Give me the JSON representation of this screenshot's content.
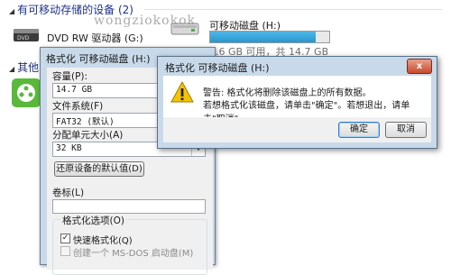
{
  "explorer": {
    "removable_header": "有可移动存储的设备 (2)",
    "other_header": "其他",
    "dvd_label": "DVD RW 驱动器 (G:)",
    "usb_title": "可移动磁盘 (H:)",
    "usb_free": "1.6 GB 可用，共 14.7 GB",
    "usb_used_fraction": 0.89
  },
  "watermark": "wongziokokok",
  "format_dialog": {
    "title": "格式化 可移动磁盘 (H:)",
    "capacity_label": "容量(P):",
    "capacity_value": "14.7 GB",
    "fs_label": "文件系统(F)",
    "fs_value": "FAT32 (默认)",
    "alloc_label": "分配单元大小(A)",
    "alloc_value": "32 KB",
    "restore_button": "还原设备的默认值(D)",
    "volume_label": "卷标(L)",
    "options_label": "格式化选项(O)",
    "quick_format_label": "快速格式化(Q)",
    "quick_format_checked": true,
    "msdos_label": "创建一个 MS-DOS 启动盘(M)"
  },
  "warning_dialog": {
    "title": "格式化 可移动磁盘 (H:)",
    "message1": "警告: 格式化将删除该磁盘上的所有数据。",
    "message2": "若想格式化该磁盘，请单击\"确定\"。若想退出，请单击\"取消\"。",
    "ok_button": "确定",
    "cancel_button": "取消",
    "close_glyph": "x"
  }
}
